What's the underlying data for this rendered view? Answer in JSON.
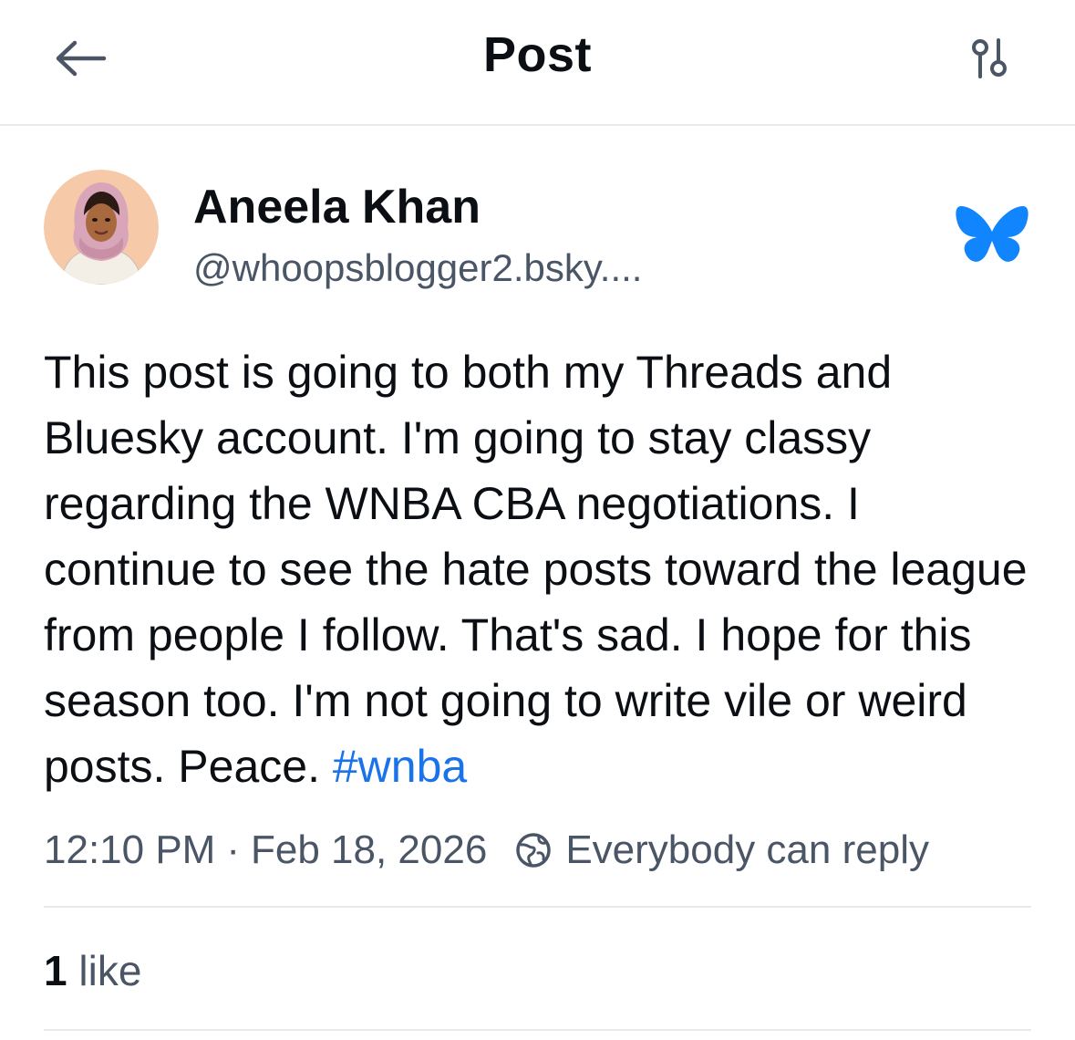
{
  "header": {
    "title": "Post",
    "back_icon": "arrow-left-icon",
    "settings_icon": "sliders-icon"
  },
  "author": {
    "name": "Aneela Khan",
    "handle": "@whoopsblogger2.bsky....",
    "avatar_icon": "avatar-illustration",
    "platform_icon": "bluesky-butterfly-icon"
  },
  "post": {
    "text": "This post is going to both my Threads and Bluesky account. I'm going to stay classy regarding the WNBA CBA negotiations. I continue to see the hate posts toward the league from people I follow. That's sad. I hope for this season too. I'm not going to write vile or weird posts. Peace. ",
    "hashtag": "#wnba",
    "time": "12:10 PM",
    "separator": "·",
    "date": "Feb 18, 2026",
    "reply_setting": "Everybody can reply"
  },
  "engagement": {
    "likes_count": "1",
    "likes_label": "like"
  },
  "colors": {
    "accent": "#1a73e8",
    "bluesky": "#1185fe",
    "muted_text": "#4a5566",
    "divider": "#e6e9ee"
  }
}
